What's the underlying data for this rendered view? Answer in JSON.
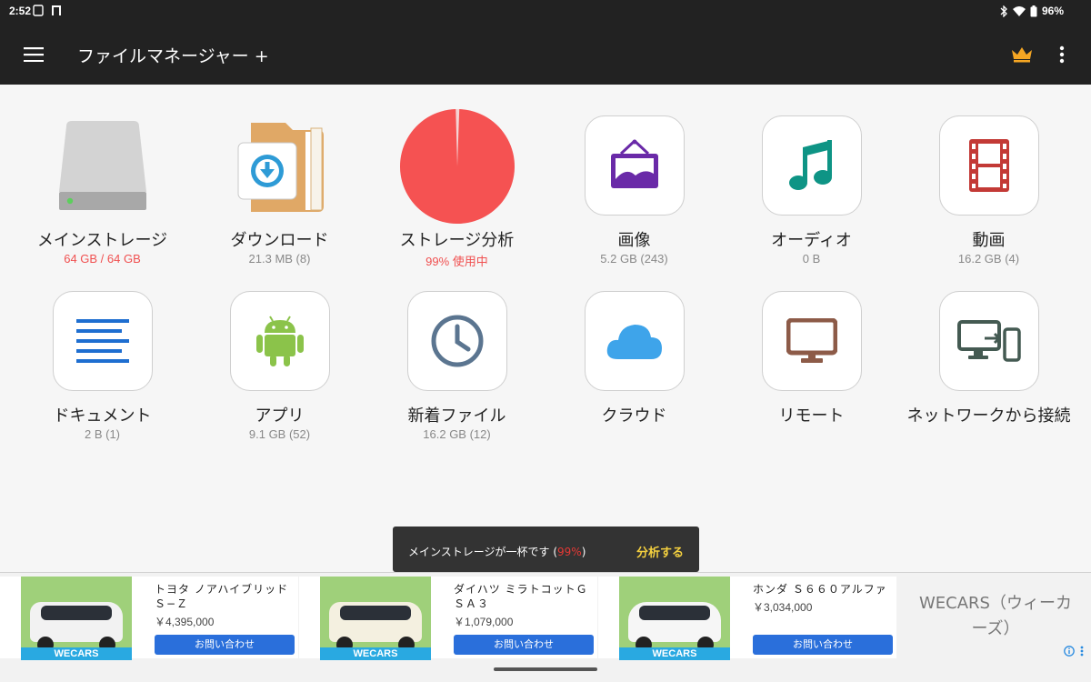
{
  "status": {
    "time": "2:52",
    "battery": "96%"
  },
  "appbar": {
    "title": "ファイルマネージャー +"
  },
  "tiles": [
    {
      "label": "メインストレージ",
      "sub": "64 GB / 64 GB"
    },
    {
      "label": "ダウンロード",
      "sub": "21.3 MB (8)"
    },
    {
      "label": "ストレージ分析",
      "sub": "99% 使用中"
    },
    {
      "label": "画像",
      "sub": "5.2 GB (243)"
    },
    {
      "label": "オーディオ",
      "sub": "0 B"
    },
    {
      "label": "動画",
      "sub": "16.2 GB (4)"
    },
    {
      "label": "ドキュメント",
      "sub": "2 B (1)"
    },
    {
      "label": "アプリ",
      "sub": "9.1 GB (52)"
    },
    {
      "label": "新着ファイル",
      "sub": "16.2 GB (12)"
    },
    {
      "label": "クラウド",
      "sub": ""
    },
    {
      "label": "リモート",
      "sub": ""
    },
    {
      "label": "ネットワークから接続",
      "sub": ""
    }
  ],
  "storage_used_fraction": 0.99,
  "snackbar": {
    "msg_before": "メインストレージが一杯です (",
    "pct": "99%",
    "msg_after": ")",
    "action": "分析する"
  },
  "ad": {
    "cards": [
      {
        "name": "トヨタ ノアハイブリッド Ｓ−Ｚ",
        "price": "￥4,395,000",
        "cta": "お問い合わせ",
        "brand": "WECARS",
        "car_color": "#f2f2f2"
      },
      {
        "name": "ダイハツ ミラトコットＧ ＳＡ３",
        "price": "￥1,079,000",
        "cta": "お問い合わせ",
        "brand": "WECARS",
        "car_color": "#f4f0e0"
      },
      {
        "name": "ホンダ Ｓ６６０アルファ",
        "price": "￥3,034,000",
        "cta": "お問い合わせ",
        "brand": "WECARS",
        "car_color": "#f6f6f6"
      }
    ],
    "advertiser": "WECARS（ウィーカーズ）"
  },
  "colors": {
    "red": "#f05050",
    "pie": "#f55252",
    "purple": "#6a2aa8",
    "teal": "#0e9485",
    "film": "#c33a36",
    "doc": "#1e6ed0",
    "android": "#8bc34a",
    "clock": "#5b7590",
    "cloud": "#3ea4ea",
    "remote": "#8d5b48",
    "network": "#445a52"
  }
}
